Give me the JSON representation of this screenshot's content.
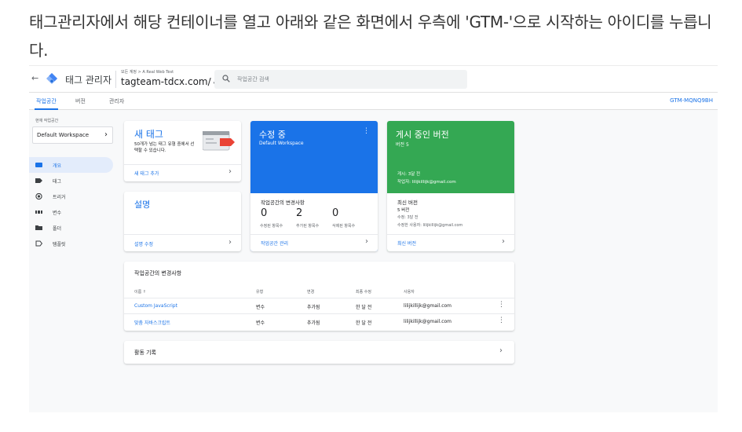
{
  "article": {
    "text": "태그관리자에서 해당 컨테이너를 열고 아래와 같은 화면에서 우측에 'GTM-'으로 시작하는 아이디를 누릅니다."
  },
  "topbar": {
    "back_icon": "←",
    "app_title": "태그 관리자",
    "breadcrumb": "모든 계정 > A Real Web Test",
    "container_name": "tagteam-tdcx.com/",
    "container_caret": "▾",
    "search_placeholder": "작업공간 검색"
  },
  "tabs": [
    {
      "label": "작업공간",
      "active": true
    },
    {
      "label": "버전",
      "active": false
    },
    {
      "label": "관리자",
      "active": false
    }
  ],
  "container_id": "GTM-MQNQ9BH",
  "sidebar": {
    "workspace_label": "현재 작업공간",
    "workspace_name": "Default Workspace",
    "workspace_chevron": "›",
    "items": [
      {
        "label": "개요",
        "icon": "overview-icon"
      },
      {
        "label": "태그",
        "icon": "tag-icon"
      },
      {
        "label": "트리거",
        "icon": "trigger-icon"
      },
      {
        "label": "변수",
        "icon": "variable-icon"
      },
      {
        "label": "폴더",
        "icon": "folder-icon"
      },
      {
        "label": "템플릿",
        "icon": "template-icon"
      }
    ]
  },
  "new_tag_card": {
    "title": "새 태그",
    "description": "50개가 넘는 태그 유형 중에서 선택할 수 있습니다.",
    "link": "새 태그 추가",
    "chevron": "›"
  },
  "description_card": {
    "title": "설명",
    "link": "설명 수정",
    "chevron": "›"
  },
  "editing_card": {
    "title": "수정 중",
    "subtitle": "Default Workspace",
    "menu": "⋮",
    "changes_title": "작업공간의 변경사항",
    "stats": [
      {
        "value": "0",
        "label": "수정된 항목수"
      },
      {
        "value": "2",
        "label": "추가된 항목수"
      },
      {
        "value": "0",
        "label": "삭제된 항목수"
      }
    ],
    "link": "작업공간 관리",
    "chevron": "›",
    "accent": "#1a73e8"
  },
  "live_card": {
    "title": "게시 중인 버전",
    "subtitle": "버전 5",
    "published": "게시: 3달 전",
    "publisher": "작업자: lilijkillijk@gmail.com",
    "latest_title": "최신 버전",
    "latest_version": "5 버전",
    "latest_modified": "수정: 3달 전",
    "latest_user": "수정한 사용자: lilijkillijk@gmail.com",
    "link": "최신 버전",
    "chevron": "›",
    "accent": "#34a853"
  },
  "changes_table": {
    "title": "작업공간의 변경사항",
    "headers": {
      "name": "이름 ↑",
      "type": "유형",
      "change": "변경",
      "modified": "최종 수정",
      "user": "사용자"
    },
    "rows": [
      {
        "name": "Custom JavaScript",
        "type": "변수",
        "change": "추가됨",
        "modified": "한 달 전",
        "user": "lilijkillijk@gmail.com",
        "menu": "⋮"
      },
      {
        "name": "맞춤 자바스크립트",
        "type": "변수",
        "change": "추가됨",
        "modified": "한 달 전",
        "user": "lilijkillijk@gmail.com",
        "menu": "⋮"
      }
    ]
  },
  "activity": {
    "title": "활동 기록",
    "chevron": "›"
  }
}
